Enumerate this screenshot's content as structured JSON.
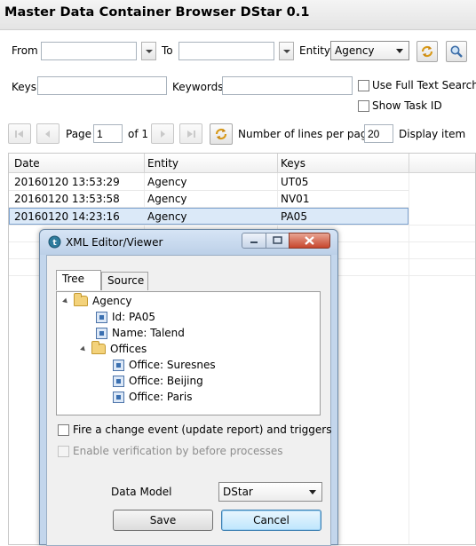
{
  "app": {
    "title": "Master Data Container Browser DStar 0.1"
  },
  "filters": {
    "from_label": "From",
    "from_value": "",
    "to_label": "To",
    "to_value": "",
    "entity_label": "Entity",
    "entity_value": "Agency",
    "keys_label": "Keys",
    "keys_value": "",
    "keywords_label": "Keywords",
    "keywords_value": "",
    "full_text_label": "Use Full Text Search",
    "full_text_checked": false,
    "task_id_label": "Show Task ID",
    "task_id_checked": false
  },
  "pager": {
    "page_label": "Page",
    "page_value": "1",
    "of_label": "of 1",
    "lines_label": "Number of lines per page:",
    "lines_value": "20",
    "display_label": "Display item"
  },
  "table": {
    "columns": [
      "Date",
      "Entity",
      "Keys"
    ],
    "rows": [
      {
        "date": "20160120 13:53:29",
        "entity": "Agency",
        "keys": "UT05"
      },
      {
        "date": "20160120 13:53:58",
        "entity": "Agency",
        "keys": "NV01"
      },
      {
        "date": "20160120 14:23:16",
        "entity": "Agency",
        "keys": "PA05"
      }
    ],
    "selected_row": 2
  },
  "dialog": {
    "title": "XML Editor/Viewer",
    "tabs": [
      "Tree",
      "Source"
    ],
    "active_tab": 0,
    "tree": [
      {
        "label": "Agency",
        "type": "folder",
        "expanded": true
      },
      {
        "label": "Id: PA05",
        "type": "element"
      },
      {
        "label": "Name: Talend",
        "type": "element"
      },
      {
        "label": "Offices",
        "type": "folder",
        "expanded": true
      },
      {
        "label": "Office: Suresnes",
        "type": "element"
      },
      {
        "label": "Office: Beijing",
        "type": "element"
      },
      {
        "label": "Office: Paris",
        "type": "element"
      }
    ],
    "fire_event_label": "Fire a change event (update report) and triggers",
    "fire_event_checked": false,
    "verification_label": "Enable verification by before processes",
    "verification_enabled": false,
    "data_model_label": "Data Model",
    "data_model_value": "DStar",
    "save_label": "Save",
    "cancel_label": "Cancel"
  },
  "colors": {
    "selection": "#dbe9f8",
    "dialog_frame": "#c3d6ec",
    "folder": "#f3d27b"
  },
  "icons": {
    "refresh": "refresh-icon",
    "search": "search-icon",
    "first": "first-page-icon",
    "prev": "prev-page-icon",
    "next": "next-page-icon",
    "last": "last-page-icon",
    "app": "talend-icon"
  }
}
